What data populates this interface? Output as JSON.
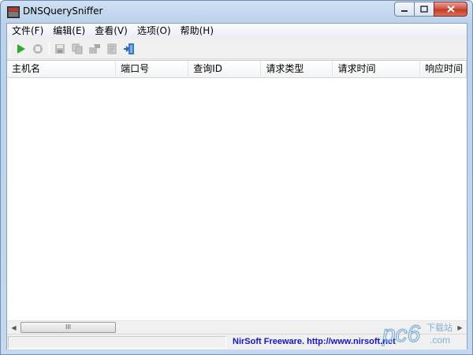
{
  "window": {
    "title": "DNSQuerySniffer",
    "minimize_icon": "minimize-icon",
    "maximize_icon": "maximize-icon",
    "close_icon": "close-icon"
  },
  "menubar": {
    "items": [
      {
        "label": "文件(F)"
      },
      {
        "label": "编辑(E)"
      },
      {
        "label": "查看(V)"
      },
      {
        "label": "选项(O)"
      },
      {
        "label": "帮助(H)"
      }
    ]
  },
  "toolbar": {
    "buttons": [
      "play-icon",
      "stop-icon",
      "save-icon",
      "copy-icon",
      "export-icon",
      "properties-icon",
      "exit-icon"
    ],
    "accent_green": "#2fa82f"
  },
  "list": {
    "columns": [
      {
        "label": "主机名"
      },
      {
        "label": "端口号"
      },
      {
        "label": "查询ID"
      },
      {
        "label": "请求类型"
      },
      {
        "label": "请求时间"
      },
      {
        "label": "响应时间"
      }
    ]
  },
  "scrollbar": {
    "thumb_grip": "III"
  },
  "statusbar": {
    "link_text": "NirSoft Freeware.  http://www.nirsoft.net"
  },
  "watermark": {
    "logo_text": "pc6",
    "site_text": "下载站",
    "domain_text": ".com"
  }
}
